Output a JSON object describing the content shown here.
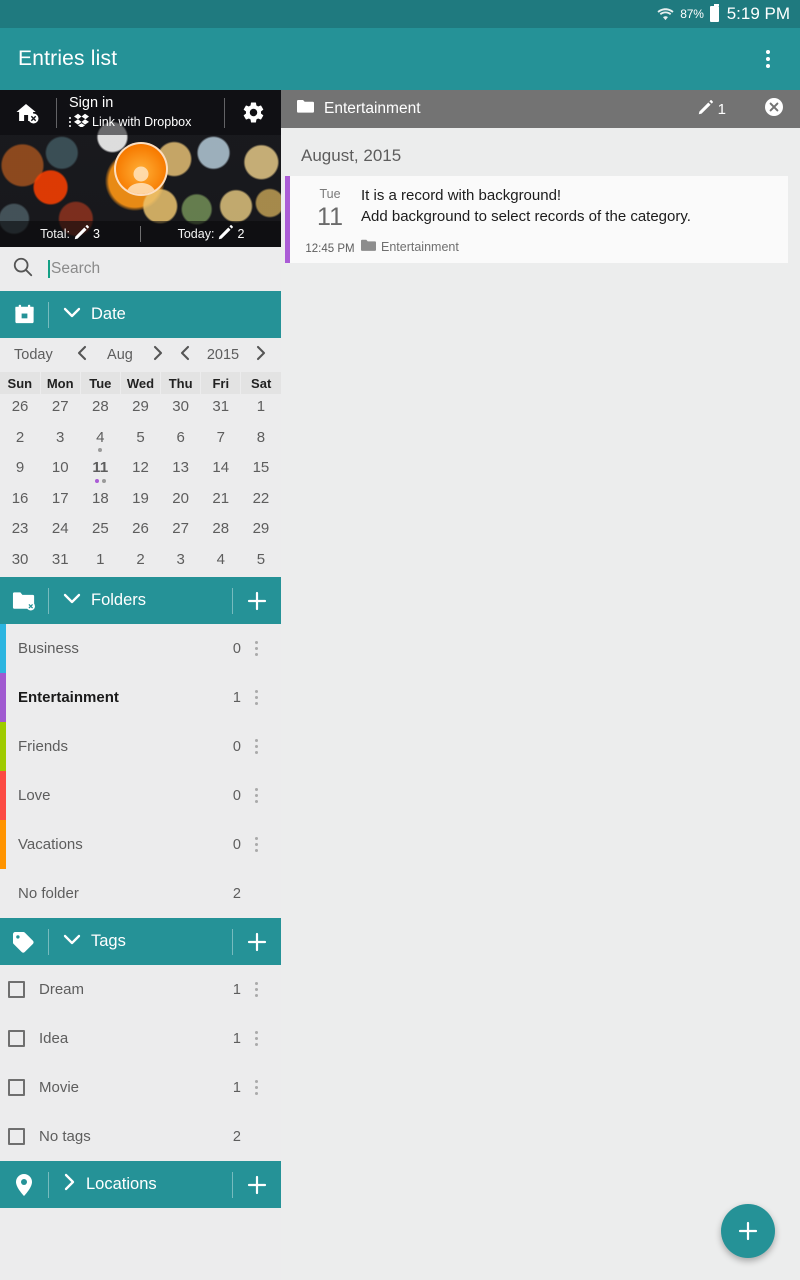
{
  "status_bar": {
    "battery_percent": "87%",
    "time": "5:19 PM",
    "wifi_icon": "wifi-icon",
    "battery_icon": "battery-icon"
  },
  "app_bar": {
    "title": "Entries list",
    "overflow_icon": "overflow-menu-icon"
  },
  "profile": {
    "home_icon": "home-off-icon",
    "sign_in": "Sign in",
    "dropbox_label": "Link with Dropbox",
    "dropbox_icon": "dropbox-icon",
    "settings_icon": "gear-icon",
    "avatar_icon": "avatar-icon",
    "total_label": "Total:",
    "total_value": "3",
    "today_label": "Today:",
    "today_value": "2",
    "pencil_icon": "pencil-icon"
  },
  "search": {
    "placeholder": "Search",
    "icon": "search-icon"
  },
  "date_section": {
    "icon": "calendar-icon",
    "label": "Date",
    "chevron": "chevron-down-icon",
    "expanded": true,
    "today_button": "Today",
    "month": "Aug",
    "year": "2015",
    "prev_icon": "chevron-left-icon",
    "next_icon": "chevron-right-icon",
    "weekdays": [
      "Sun",
      "Mon",
      "Tue",
      "Wed",
      "Thu",
      "Fri",
      "Sat"
    ],
    "weeks": [
      [
        {
          "d": "26",
          "muted": true
        },
        {
          "d": "27",
          "muted": true
        },
        {
          "d": "28",
          "muted": true
        },
        {
          "d": "29",
          "muted": true
        },
        {
          "d": "30",
          "muted": true
        },
        {
          "d": "31",
          "muted": true
        },
        {
          "d": "1",
          "muted": false
        }
      ],
      [
        {
          "d": "2"
        },
        {
          "d": "3"
        },
        {
          "d": "4",
          "dots": [
            "#9a9a9a"
          ]
        },
        {
          "d": "5"
        },
        {
          "d": "6"
        },
        {
          "d": "7"
        },
        {
          "d": "8"
        }
      ],
      [
        {
          "d": "9"
        },
        {
          "d": "10"
        },
        {
          "d": "11",
          "selected": true,
          "dots": [
            "#ab5cd6",
            "#9a9a9a"
          ]
        },
        {
          "d": "12"
        },
        {
          "d": "13"
        },
        {
          "d": "14"
        },
        {
          "d": "15"
        }
      ],
      [
        {
          "d": "16"
        },
        {
          "d": "17"
        },
        {
          "d": "18"
        },
        {
          "d": "19"
        },
        {
          "d": "20"
        },
        {
          "d": "21"
        },
        {
          "d": "22"
        }
      ],
      [
        {
          "d": "23"
        },
        {
          "d": "24"
        },
        {
          "d": "25"
        },
        {
          "d": "26"
        },
        {
          "d": "27"
        },
        {
          "d": "28"
        },
        {
          "d": "29"
        }
      ],
      [
        {
          "d": "30"
        },
        {
          "d": "31"
        },
        {
          "d": "1",
          "muted": true
        },
        {
          "d": "2",
          "muted": true
        },
        {
          "d": "3",
          "muted": true
        },
        {
          "d": "4",
          "muted": true
        },
        {
          "d": "5",
          "muted": true
        }
      ]
    ]
  },
  "folders_section": {
    "icon": "folder-off-icon",
    "label": "Folders",
    "chevron": "chevron-down-icon",
    "add_icon": "plus-icon",
    "items": [
      {
        "name": "Business",
        "count": "0",
        "color": "#2cb5e0",
        "selected": false,
        "menu_icon": "overflow-menu-icon"
      },
      {
        "name": "Entertainment",
        "count": "1",
        "color": "#a05ad0",
        "selected": true,
        "menu_icon": "overflow-menu-icon"
      },
      {
        "name": "Friends",
        "count": "0",
        "color": "#9ecb00",
        "selected": false,
        "menu_icon": "overflow-menu-icon"
      },
      {
        "name": "Love",
        "count": "0",
        "color": "#fc4a44",
        "selected": false,
        "menu_icon": "overflow-menu-icon"
      },
      {
        "name": "Vacations",
        "count": "0",
        "color": "#ff9400",
        "selected": false,
        "menu_icon": "overflow-menu-icon"
      },
      {
        "name": "No folder",
        "count": "2",
        "color": "",
        "selected": false,
        "menu_icon": ""
      }
    ]
  },
  "tags_section": {
    "icon": "tag-icon",
    "label": "Tags",
    "chevron": "chevron-down-icon",
    "add_icon": "plus-icon",
    "items": [
      {
        "name": "Dream",
        "count": "1",
        "checked": false,
        "menu_icon": "overflow-menu-icon"
      },
      {
        "name": "Idea",
        "count": "1",
        "checked": false,
        "menu_icon": "overflow-menu-icon"
      },
      {
        "name": "Movie",
        "count": "1",
        "checked": false,
        "menu_icon": "overflow-menu-icon"
      },
      {
        "name": "No tags",
        "count": "2",
        "checked": false,
        "menu_icon": ""
      }
    ]
  },
  "locations_section": {
    "icon": "location-pin-icon",
    "label": "Locations",
    "chevron": "chevron-right-icon",
    "add_icon": "plus-icon",
    "expanded": false
  },
  "content": {
    "category_bar": {
      "folder_icon": "folder-icon",
      "title": "Entertainment",
      "pencil_icon": "pencil-icon",
      "count": "1",
      "close_icon": "close-circle-icon"
    },
    "month_group": "August, 2015",
    "entries": [
      {
        "stripe_color": "#ab5cd6",
        "day_of_week": "Tue",
        "day": "11",
        "time": "12:45 PM",
        "title": "It is a record with background!",
        "description": "Add background to select records of the category.",
        "folder_icon": "folder-icon",
        "folder": "Entertainment"
      }
    ],
    "fab": {
      "icon": "plus-icon",
      "label": "+"
    }
  },
  "theme": {
    "teal": "#259297",
    "teal_dark": "#1f7a7f",
    "gray_bar": "#737373",
    "bg": "#ececed",
    "accent_purple": "#ab5cd6"
  }
}
